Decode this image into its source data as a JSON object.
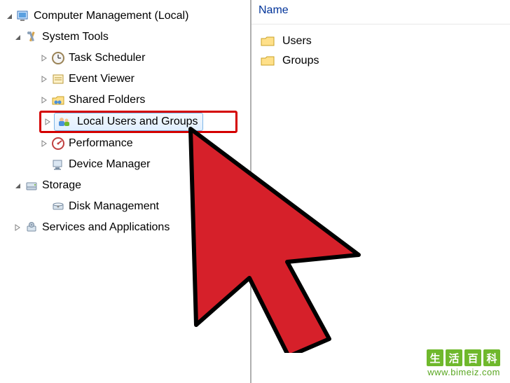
{
  "tree": {
    "root": {
      "label": "Computer Management (Local)"
    },
    "systemTools": {
      "label": "System Tools"
    },
    "taskScheduler": {
      "label": "Task Scheduler"
    },
    "eventViewer": {
      "label": "Event Viewer"
    },
    "sharedFolders": {
      "label": "Shared Folders"
    },
    "localUsersGroups": {
      "label": "Local Users and Groups"
    },
    "performance": {
      "label": "Performance"
    },
    "deviceManager": {
      "label": "Device Manager"
    },
    "storage": {
      "label": "Storage"
    },
    "diskManagement": {
      "label": "Disk Management"
    },
    "servicesApps": {
      "label": "Services and Applications"
    }
  },
  "listHeader": "Name",
  "listItems": {
    "users": "Users",
    "groups": "Groups"
  },
  "watermark": {
    "chars": [
      "生",
      "活",
      "百",
      "科"
    ],
    "url": "www.bimeiz.com"
  }
}
